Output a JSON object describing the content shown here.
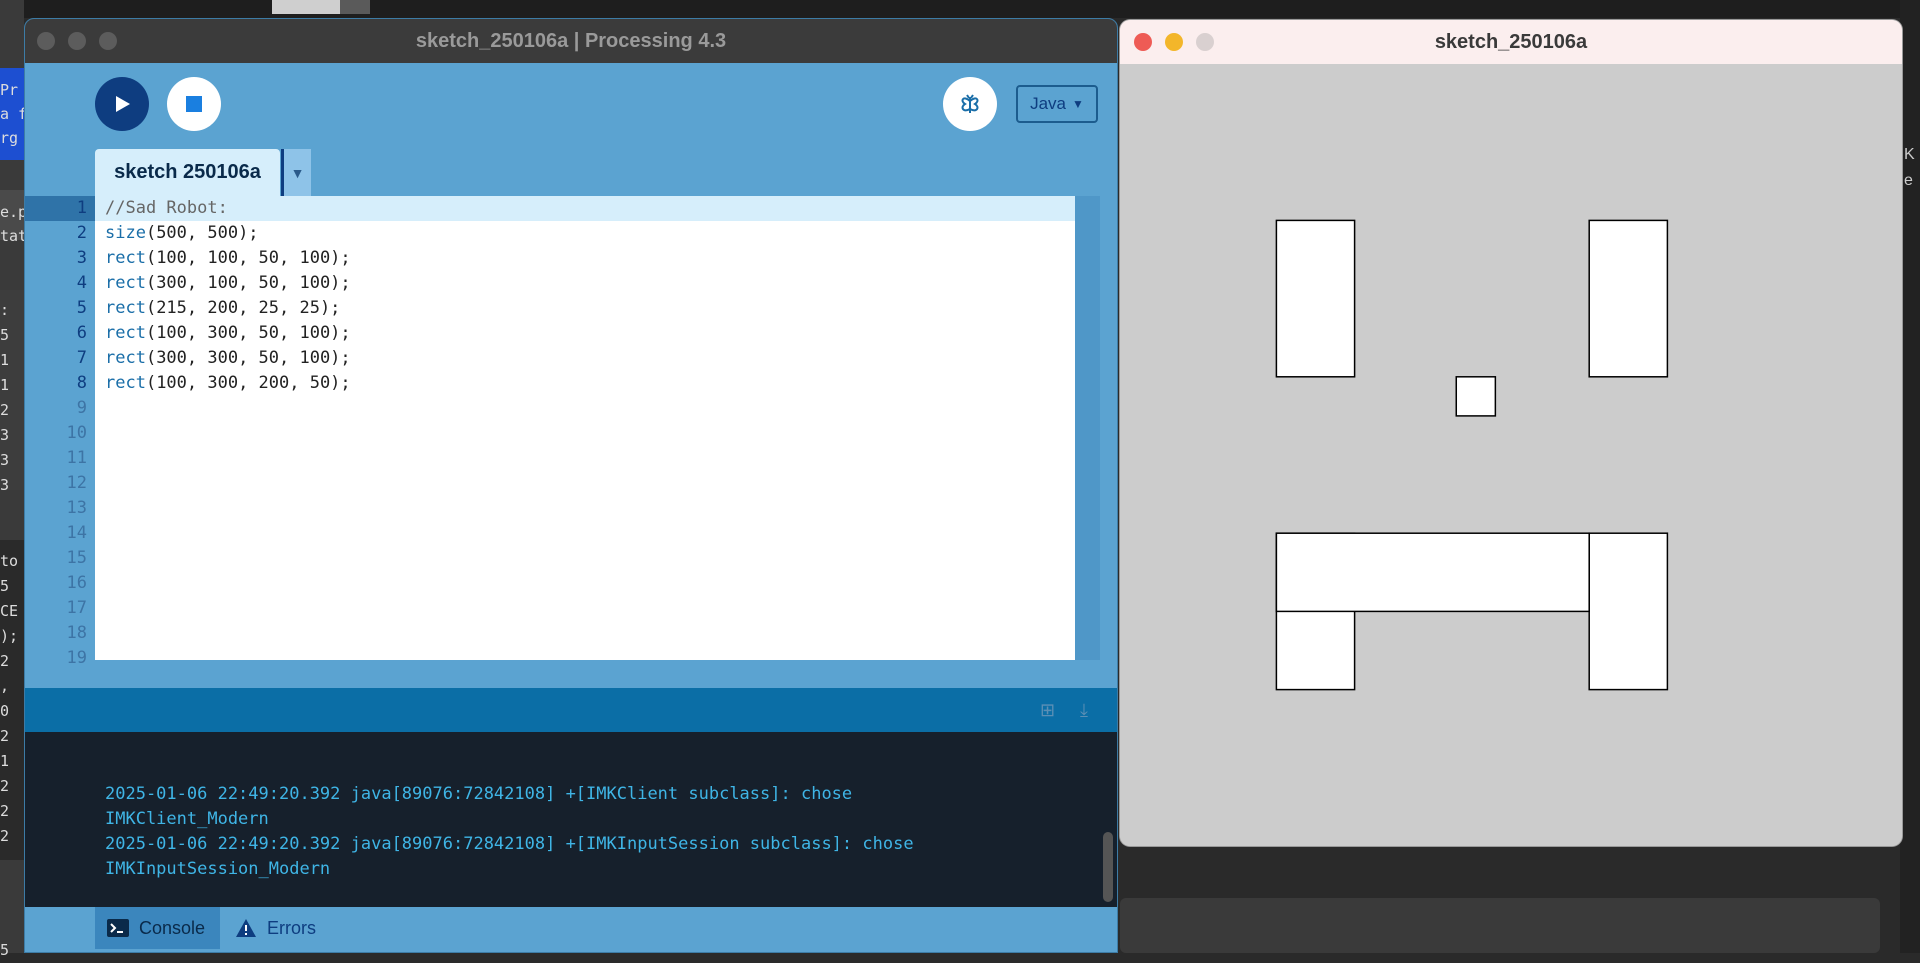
{
  "background": {
    "left_fragments": [
      "Pr",
      "a fl",
      "rg",
      "e.p",
      "tat",
      ":",
      "5",
      "1",
      "1",
      "2",
      "3",
      "3",
      "3",
      "to",
      "5",
      "CE",
      ");",
      "2",
      ",",
      "0",
      "2",
      "1",
      "2",
      "2",
      "2",
      "5"
    ],
    "right_fragments": [
      "K",
      "e"
    ]
  },
  "ide": {
    "title": "sketch_250106a | Processing 4.3",
    "toolbar": {
      "run_icon": "play-icon",
      "stop_icon": "stop-icon",
      "debug_icon": "butterfly-icon",
      "mode_label": "Java",
      "mode_arrow": "▼"
    },
    "tab": {
      "label": "sketch 250106a",
      "menu_arrow": "▼"
    },
    "editor": {
      "current_line": 1,
      "line_numbers": [
        "1",
        "2",
        "3",
        "4",
        "5",
        "6",
        "7",
        "8",
        "9",
        "10",
        "11",
        "12",
        "13",
        "14",
        "15",
        "16",
        "17",
        "18",
        "19"
      ],
      "lines": [
        {
          "fn": "",
          "args": "//Sad Robot:"
        },
        {
          "fn": "size",
          "args": "(500, 500);"
        },
        {
          "fn": "rect",
          "args": "(100, 100, 50, 100);"
        },
        {
          "fn": "rect",
          "args": "(300, 100, 50, 100);"
        },
        {
          "fn": "rect",
          "args": "(215, 200, 25, 25);"
        },
        {
          "fn": "rect",
          "args": "(100, 300, 50, 100);"
        },
        {
          "fn": "rect",
          "args": "(300, 300, 50, 100);"
        },
        {
          "fn": "rect",
          "args": "(100, 300, 200, 50);"
        }
      ]
    },
    "console": {
      "lines": [
        "2025-01-06 22:49:20.392 java[89076:72842108] +[IMKClient subclass]: chose",
        "IMKClient_Modern",
        "2025-01-06 22:49:20.392 java[89076:72842108] +[IMKInputSession subclass]: chose",
        "IMKInputSession_Modern"
      ]
    },
    "bottom_tabs": {
      "console_label": "Console",
      "errors_label": "Errors"
    }
  },
  "sketch": {
    "title": "sketch_250106a",
    "canvas_size": [
      500,
      500
    ],
    "background_color": "#cccccc",
    "rects": [
      [
        100,
        100,
        50,
        100
      ],
      [
        300,
        100,
        50,
        100
      ],
      [
        215,
        200,
        25,
        25
      ],
      [
        100,
        300,
        50,
        100
      ],
      [
        300,
        300,
        50,
        100
      ],
      [
        100,
        300,
        200,
        50
      ]
    ]
  },
  "colors": {
    "ide_blue": "#5ba3d1",
    "run_button": "#0e3d80",
    "keyword": "#1a6ea8",
    "console_text": "#3fb5e6",
    "console_bg": "#16202c"
  }
}
